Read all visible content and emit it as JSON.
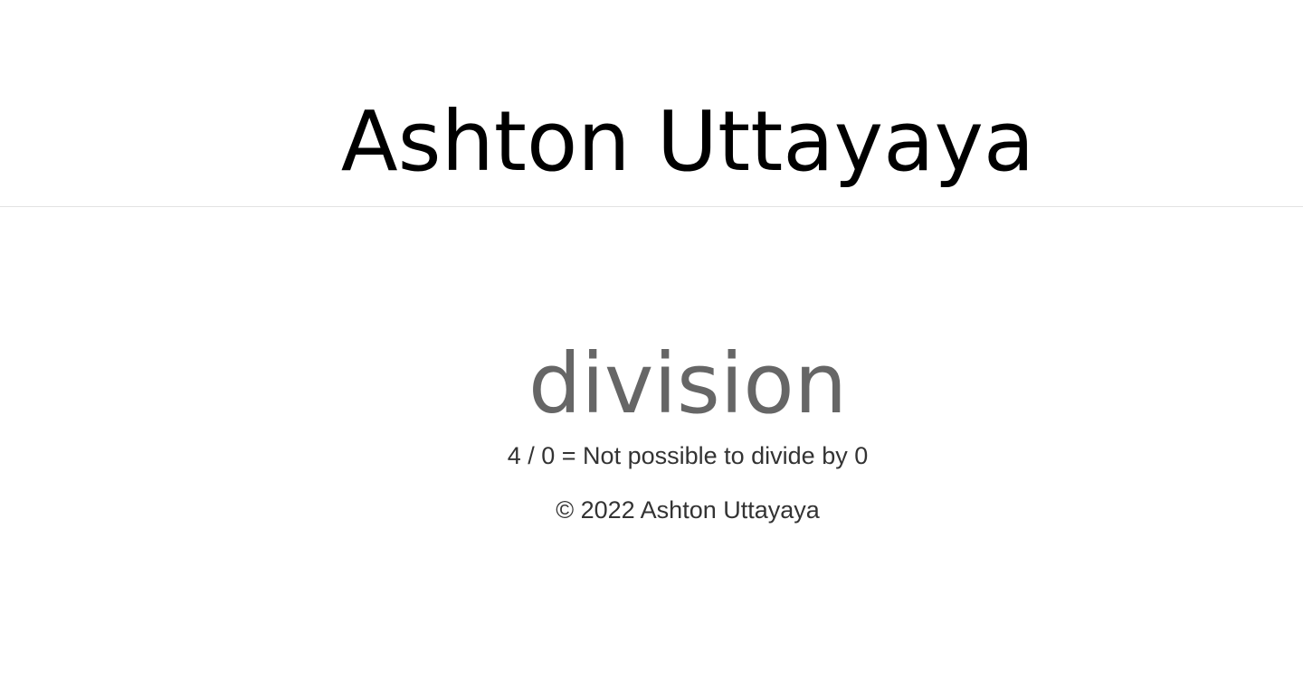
{
  "header": {
    "site_title": "Ashton Uttayaya"
  },
  "main": {
    "heading": "division",
    "result": "4 / 0 = Not possible to divide by 0"
  },
  "footer": {
    "copyright": "© 2022 Ashton Uttayaya"
  },
  "colors": {
    "title": "#000000",
    "heading": "#666666",
    "body_text": "#333333",
    "divider": "#e3e3e3",
    "background": "#ffffff"
  }
}
